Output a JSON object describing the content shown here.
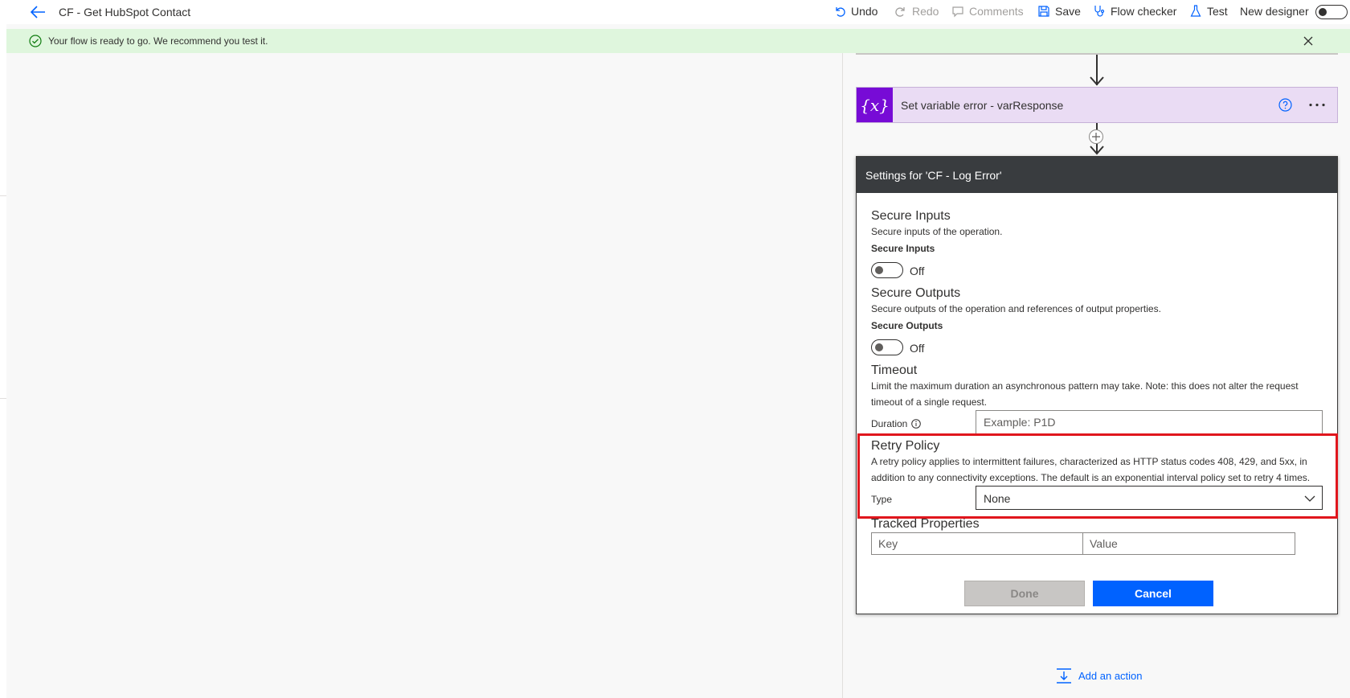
{
  "header": {
    "flow_title": "CF - Get HubSpot Contact",
    "commands": {
      "undo": "Undo",
      "redo": "Redo",
      "comments": "Comments",
      "save": "Save",
      "flow_checker": "Flow checker",
      "test": "Test",
      "new_designer": "New designer"
    }
  },
  "banner": {
    "message": "Your flow is ready to go. We recommend you test it."
  },
  "canvas": {
    "action_card": {
      "icon": "{x}",
      "title": "Set variable error - varResponse"
    },
    "add_action": "Add an action"
  },
  "settings": {
    "title": "Settings for 'CF - Log Error'",
    "secure_inputs": {
      "title": "Secure Inputs",
      "description": "Secure inputs of the operation.",
      "label": "Secure Inputs",
      "state": "Off"
    },
    "secure_outputs": {
      "title": "Secure Outputs",
      "description": "Secure outputs of the operation and references of output properties.",
      "label": "Secure Outputs",
      "state": "Off"
    },
    "timeout": {
      "title": "Timeout",
      "description_line1": "Limit the maximum duration an asynchronous pattern may take. Note: this does not alter the request",
      "description_line2": "timeout of a single request.",
      "duration_label": "Duration",
      "duration_placeholder": "Example: P1D"
    },
    "retry_policy": {
      "title": "Retry Policy",
      "description_line1": "A retry policy applies to intermittent failures, characterized as HTTP status codes 408, 429, and 5xx, in",
      "description_line2": "addition to any connectivity exceptions. The default is an exponential interval policy set to retry 4 times.",
      "type_label": "Type",
      "type_value": "None"
    },
    "tracked_properties": {
      "title": "Tracked Properties",
      "key_placeholder": "Key",
      "value_placeholder": "Value"
    },
    "buttons": {
      "done": "Done",
      "cancel": "Cancel"
    }
  },
  "colors": {
    "accent": "#0062ff",
    "banner_bg": "#dff6dd",
    "variable_icon": "#770bd6",
    "variable_card": "#eadcf4",
    "panel_header": "#393c3f",
    "highlight": "#e0161d"
  }
}
